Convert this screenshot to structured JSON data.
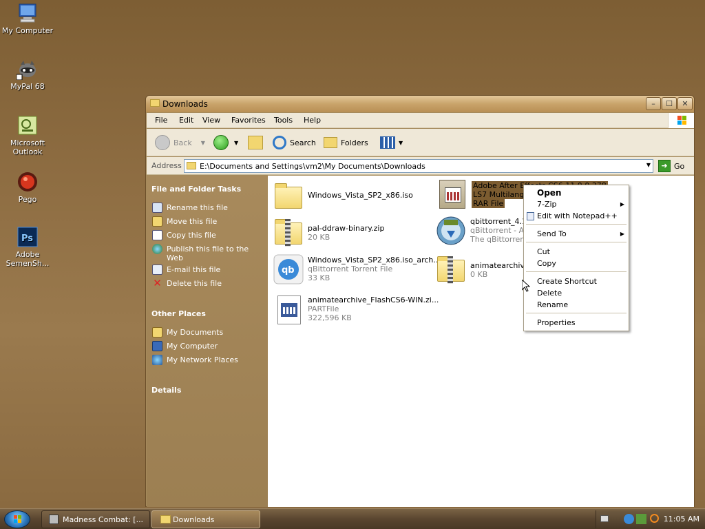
{
  "desktop": {
    "icons": [
      {
        "label": "My Computer"
      },
      {
        "label": "MyPal 68"
      },
      {
        "label": "Microsoft Outlook"
      },
      {
        "label": "Pego"
      },
      {
        "label": "Adobe SemenSh..."
      }
    ]
  },
  "window": {
    "title": "Downloads",
    "buttons": {
      "minimize": "–",
      "maximize": "☐",
      "close": "✕"
    }
  },
  "menubar": {
    "items": [
      "File",
      "Edit",
      "View",
      "Favorites",
      "Tools",
      "Help"
    ]
  },
  "toolbar": {
    "back": "Back",
    "search": "Search",
    "folders": "Folders"
  },
  "addressbar": {
    "label": "Address",
    "path": "E:\\Documents and Settings\\vm2\\My Documents\\Downloads",
    "go": "Go"
  },
  "taskpane": {
    "file_tasks_header": "File and Folder Tasks",
    "file_tasks": [
      "Rename this file",
      "Move this file",
      "Copy this file",
      "Publish this file to the Web",
      "E-mail this file",
      "Delete this file"
    ],
    "other_places_header": "Other Places",
    "other_places": [
      "My Documents",
      "My Computer",
      "My Network Places"
    ],
    "details_header": "Details"
  },
  "files": [
    {
      "name": "Windows_Vista_SP2_x86.iso",
      "type": "",
      "size": ""
    },
    {
      "name": "Adobe After Effects CS6 11.0.0.378",
      "line2": "LS7 Multilangu",
      "type": "RAR File",
      "size": ""
    },
    {
      "name": "pal-ddraw-binary.zip",
      "type": "",
      "size": "20 KB"
    },
    {
      "name": "qbittorrent_4.1",
      "type": "qBittorrent - A",
      "size": "The qBittorrent"
    },
    {
      "name": "Windows_Vista_SP2_x86.iso_arch...",
      "type": "qBittorrent Torrent File",
      "size": "33 KB"
    },
    {
      "name": "animatearchive",
      "type": "0 KB",
      "size": ""
    },
    {
      "name": "animatearchive_FlashCS6-WIN.zi...",
      "type": "PARTFile",
      "size": "322,596 KB"
    }
  ],
  "context_menu": {
    "items": [
      {
        "label": "Open"
      },
      {
        "label": "7-Zip"
      },
      {
        "label": "Edit with Notepad++"
      },
      {
        "label": "Send To"
      },
      {
        "label": "Cut"
      },
      {
        "label": "Copy"
      },
      {
        "label": "Create Shortcut"
      },
      {
        "label": "Delete"
      },
      {
        "label": "Rename"
      },
      {
        "label": "Properties"
      }
    ]
  },
  "taskbar": {
    "tasks": [
      {
        "label": "Madness Combat: [..."
      },
      {
        "label": "Downloads"
      }
    ],
    "clock": "11:05 AM"
  },
  "colors": {
    "accent": "#7c5c30",
    "taskbar": "#5a4630",
    "window_frame": "#a58a5c"
  }
}
